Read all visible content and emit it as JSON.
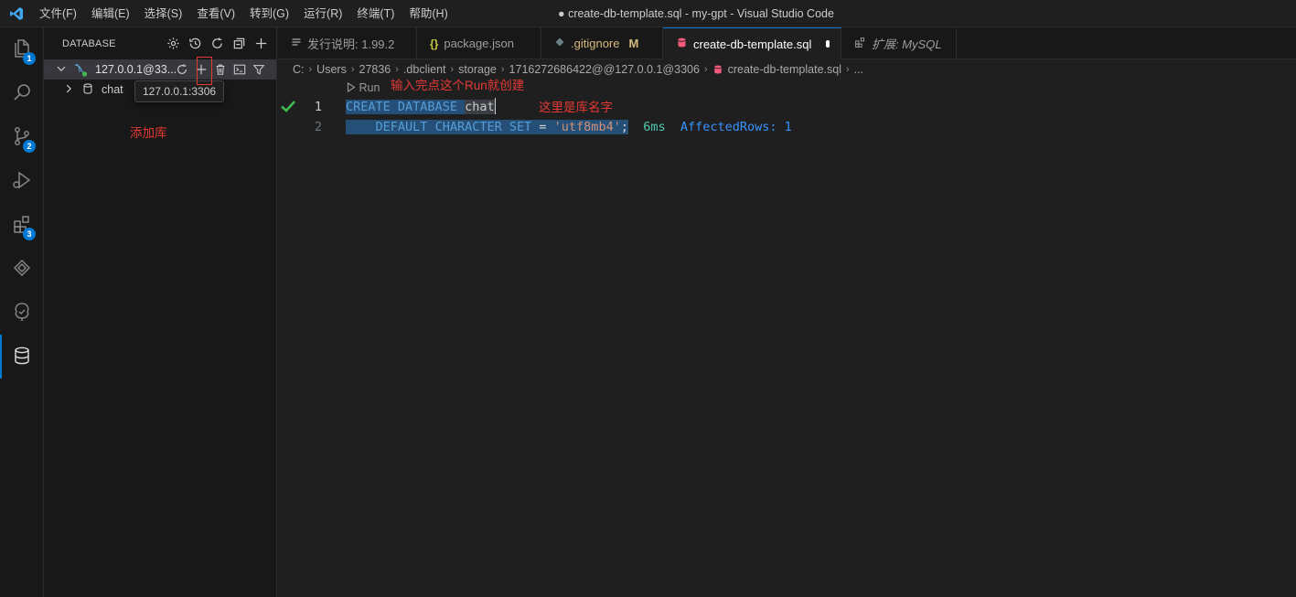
{
  "titlebar": {
    "menu": [
      "文件(F)",
      "编辑(E)",
      "选择(S)",
      "查看(V)",
      "转到(G)",
      "运行(R)",
      "终端(T)",
      "帮助(H)"
    ],
    "window_title": "● create-db-template.sql - my-gpt - Visual Studio Code"
  },
  "activitybar": {
    "badges": {
      "explorer": "1",
      "source_control": "2",
      "extensions": "3"
    }
  },
  "sidebar": {
    "title": "DATABASE",
    "connection_label": "127.0.0.1@33...",
    "database_label": "chat",
    "tooltip": "127.0.0.1:3306"
  },
  "annotations": {
    "add_db": "添加库",
    "run_hint": "输入完点这个Run就创建",
    "db_name_hint": "这里是库名字"
  },
  "tabs": [
    {
      "label": "发行说明: 1.99.2"
    },
    {
      "label": "package.json"
    },
    {
      "label": ".gitignore",
      "badge": "M"
    },
    {
      "label": "create-db-template.sql"
    },
    {
      "label": "扩展: MySQL"
    }
  ],
  "breadcrumb": [
    "C:",
    "Users",
    "27836",
    ".dbclient",
    "storage",
    "1716272686422@@127.0.0.1@3306",
    "create-db-template.sql",
    "..."
  ],
  "editor": {
    "codelens": "Run",
    "line_numbers": [
      "1",
      "2"
    ],
    "line1": {
      "kw1": "CREATE",
      "kw2": "DATABASE",
      "name": "chat"
    },
    "line2": {
      "indent": "    ",
      "kw1": "DEFAULT",
      "kw2": "CHARACTER",
      "kw3": "SET",
      "op": "=",
      "str": "'utf8mb4'",
      "semi": ";"
    },
    "inline_time": "6ms",
    "inline_rows": "AffectedRows: 1"
  },
  "colors": {
    "accent": "#0078d4",
    "annotation_red": "#e53935",
    "success_green": "#3fb950"
  }
}
